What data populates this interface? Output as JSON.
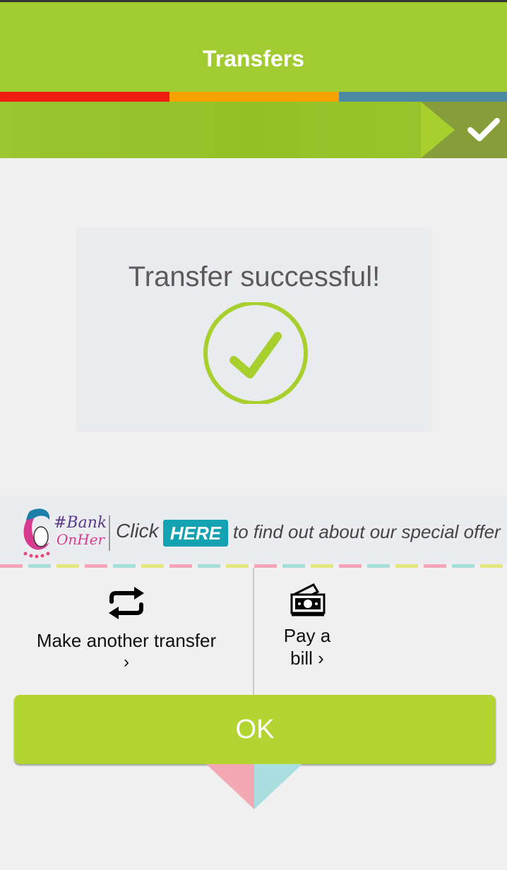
{
  "header": {
    "title": "Transfers"
  },
  "stripes": {
    "colors": [
      "#ef1c12",
      "#f8a202",
      "#4b8aa0"
    ]
  },
  "progress": {
    "completed": true,
    "icon": "check-icon"
  },
  "result": {
    "message": "Transfer successful!",
    "icon": "check-circle-icon",
    "accent": "#a7cf2d"
  },
  "banner": {
    "logo_text_line1": "#Bank",
    "logo_text_line2": "OnHer",
    "click": "Click",
    "here": "HERE",
    "rest": "to find out about our special offer"
  },
  "actions": {
    "transfer": {
      "label": "Make another transfer",
      "chevron": "›",
      "icon": "repeat-arrows-icon"
    },
    "bill": {
      "label_line1": "Pay a",
      "label_line2": "bill ›",
      "icon": "money-bill-icon"
    }
  },
  "ok_button": {
    "label": "OK"
  },
  "colors": {
    "brand_green": "#a1cb30",
    "button_green": "#b2d531",
    "here_teal": "#13a2b1"
  }
}
